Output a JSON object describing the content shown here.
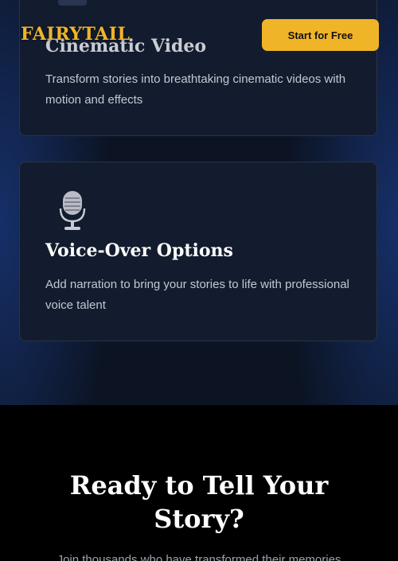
{
  "header": {
    "logo_text": "FAIRYTAIL",
    "cta_label": "Start for Free"
  },
  "features": [
    {
      "icon": "clapperboard-icon",
      "title": "Cinematic Video",
      "description": "Transform stories into breathtaking cinematic videos with motion and effects"
    },
    {
      "icon": "microphone-icon",
      "title": "Voice-Over Options",
      "description": "Add narration to bring your stories to life with professional voice talent"
    }
  ],
  "cta_section": {
    "heading": "Ready to Tell Your Story?",
    "subtext": "Join thousands who have transformed their memories"
  },
  "colors": {
    "accent": "#f0b428",
    "card_background": "#131c2e",
    "page_background": "#0c1424"
  }
}
